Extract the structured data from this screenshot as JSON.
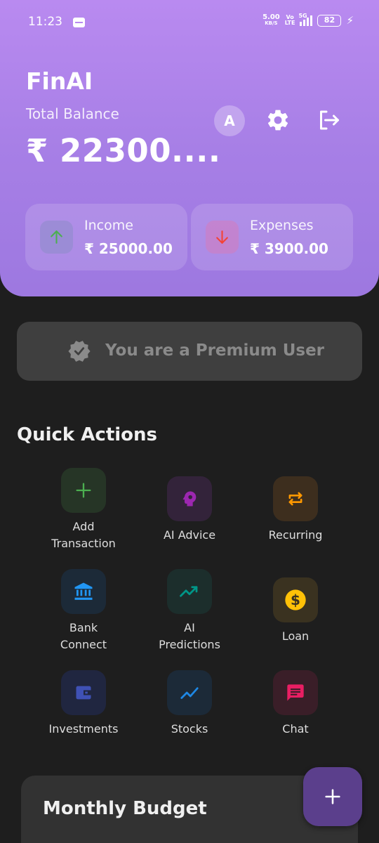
{
  "status_bar": {
    "time": "11:23",
    "speed_value": "5.00",
    "speed_unit": "KB/S",
    "volte_top": "Vo",
    "volte_bottom": "LTE",
    "network": "5G",
    "battery": "82"
  },
  "header": {
    "app_title": "FinAI",
    "balance_label": "Total Balance",
    "balance_value": "₹ 22300....",
    "avatar_letter": "A"
  },
  "income": {
    "label": "Income",
    "value": "₹ 25000.00",
    "color": "#4caf50"
  },
  "expenses": {
    "label": "Expenses",
    "value": "₹ 3900.00",
    "color": "#f44336"
  },
  "premium": {
    "text": "You are a Premium User"
  },
  "quick_actions": {
    "title": "Quick Actions",
    "items": [
      {
        "label": "Add\nTransaction",
        "icon": "plus-icon",
        "color": "#4caf50"
      },
      {
        "label": "AI Advice",
        "icon": "brain-icon",
        "color": "#9c27b0"
      },
      {
        "label": "Recurring",
        "icon": "repeat-icon",
        "color": "#ff9800"
      },
      {
        "label": "Bank\nConnect",
        "icon": "bank-icon",
        "color": "#2196f3"
      },
      {
        "label": "AI\nPredictions",
        "icon": "trending-up-icon",
        "color": "#009688"
      },
      {
        "label": "Loan",
        "icon": "dollar-icon",
        "color": "#ffc107"
      },
      {
        "label": "Investments",
        "icon": "wallet-icon",
        "color": "#3f51b5"
      },
      {
        "label": "Stocks",
        "icon": "chart-line-icon",
        "color": "#1e88e5"
      },
      {
        "label": "Chat",
        "icon": "chat-icon",
        "color": "#e91e63"
      }
    ]
  },
  "budget": {
    "title": "Monthly Budget"
  }
}
